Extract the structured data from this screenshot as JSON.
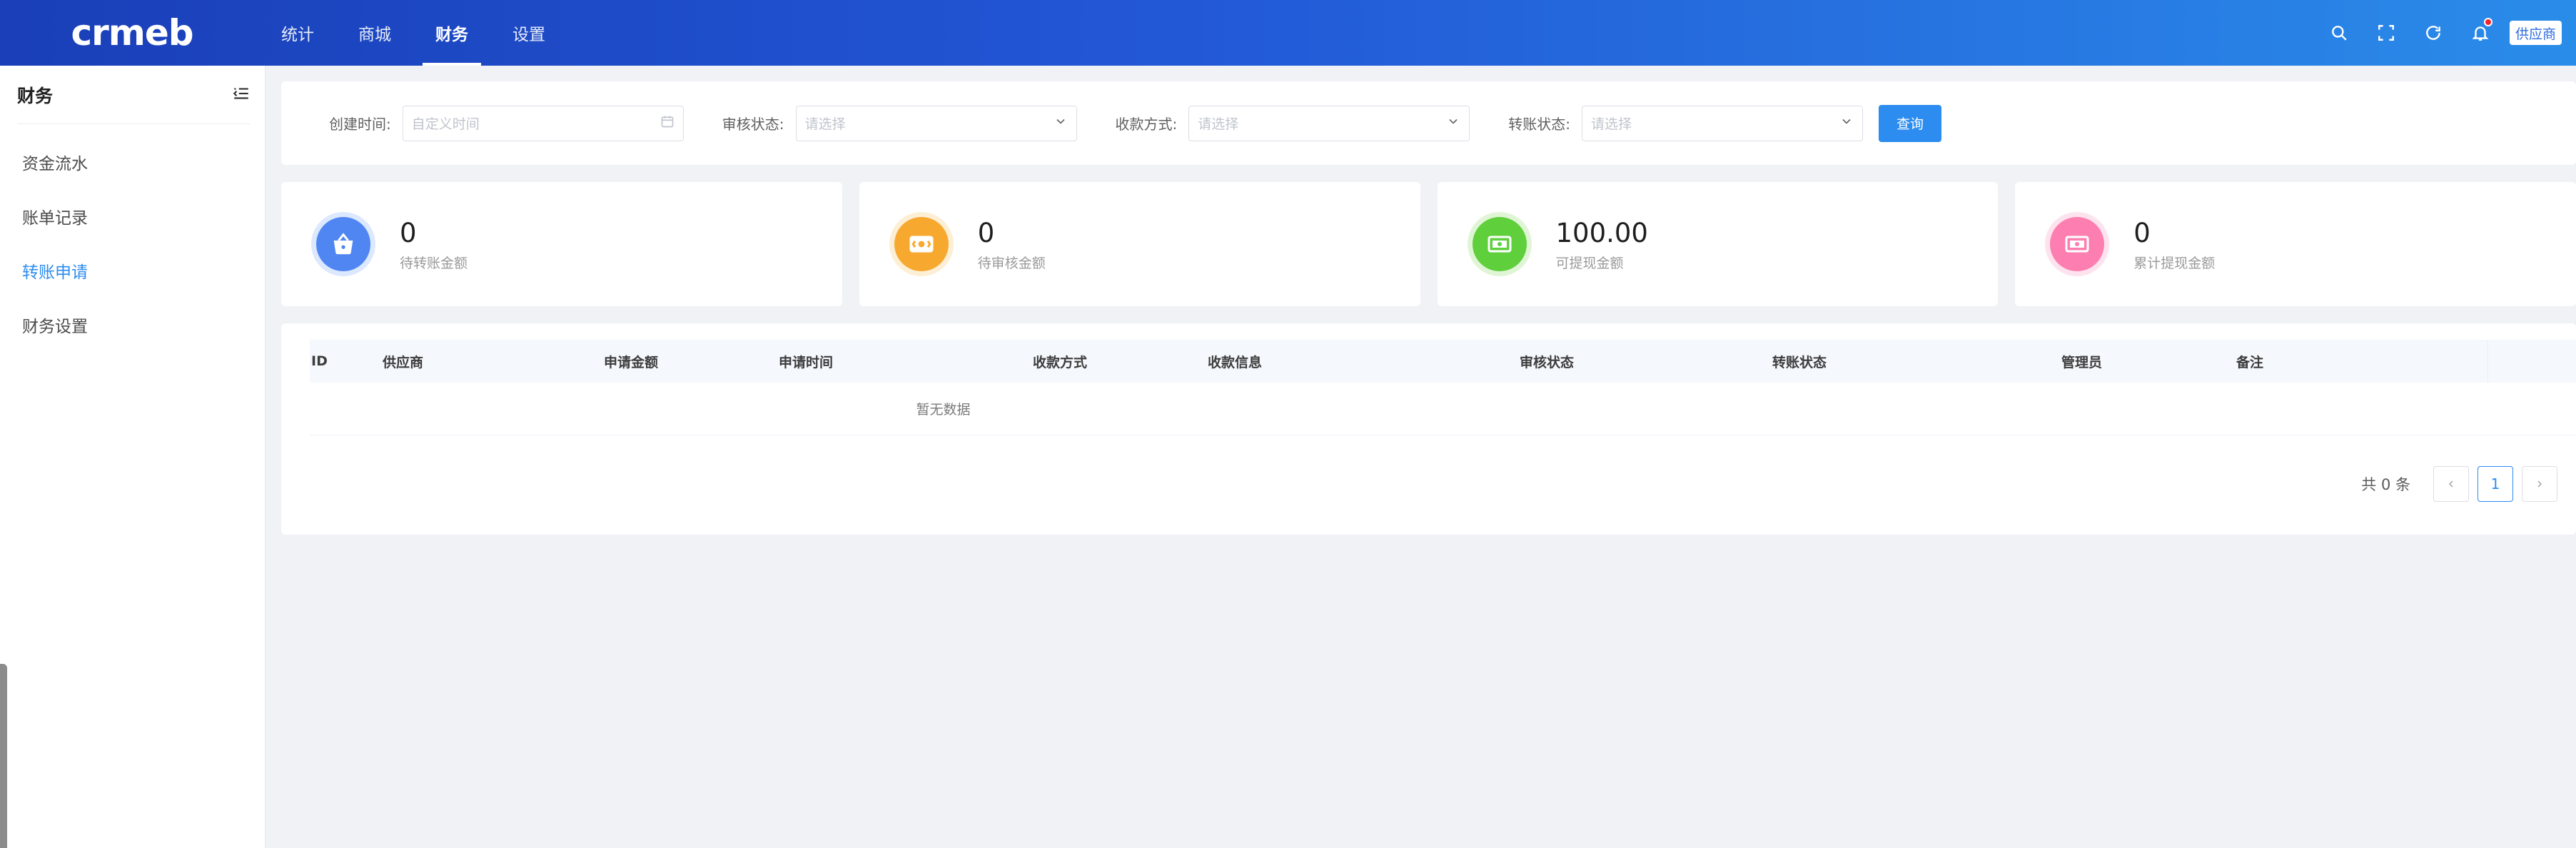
{
  "header": {
    "logo_text": "crmeb",
    "nav": [
      {
        "label": "统计"
      },
      {
        "label": "商城"
      },
      {
        "label": "财务"
      },
      {
        "label": "设置"
      }
    ],
    "active_nav": "财务",
    "user_label": "供应商",
    "icons": [
      "search-icon",
      "fullscreen-icon",
      "refresh-icon",
      "bell-icon"
    ]
  },
  "sidebar": {
    "title": "财务",
    "items": [
      {
        "label": "资金流水"
      },
      {
        "label": "账单记录"
      },
      {
        "label": "转账申请"
      },
      {
        "label": "财务设置"
      }
    ],
    "active_item": "转账申请"
  },
  "filters": {
    "created_label": "创建时间:",
    "created_placeholder": "自定义时间",
    "audit_label": "审核状态:",
    "audit_placeholder": "请选择",
    "payment_label": "收款方式:",
    "payment_placeholder": "请选择",
    "transfer_label": "转账状态:",
    "transfer_placeholder": "请选择",
    "query_label": "查询"
  },
  "stats": [
    {
      "value": "0",
      "label": "待转账金额",
      "color": "#4f86f2",
      "ring": "#dce8fd",
      "icon": "basket-icon"
    },
    {
      "value": "0",
      "label": "待审核金额",
      "color": "#f7a92f",
      "ring": "#fdefd6",
      "icon": "cash-icon"
    },
    {
      "value": "100.00",
      "label": "可提现金额",
      "color": "#5fcf3c",
      "ring": "#e0f5d6",
      "icon": "money-icon"
    },
    {
      "value": "0",
      "label": "累计提现金额",
      "color": "#fd7fb1",
      "ring": "#fde3ee",
      "icon": "wallet-icon"
    }
  ],
  "table": {
    "columns": [
      "ID",
      "供应商",
      "申请金额",
      "申请时间",
      "收款方式",
      "收款信息",
      "审核状态",
      "转账状态",
      "管理员",
      "备注"
    ],
    "empty_text": "暂无数据"
  },
  "pager": {
    "total_text": "共 0 条",
    "current_page": "1"
  }
}
